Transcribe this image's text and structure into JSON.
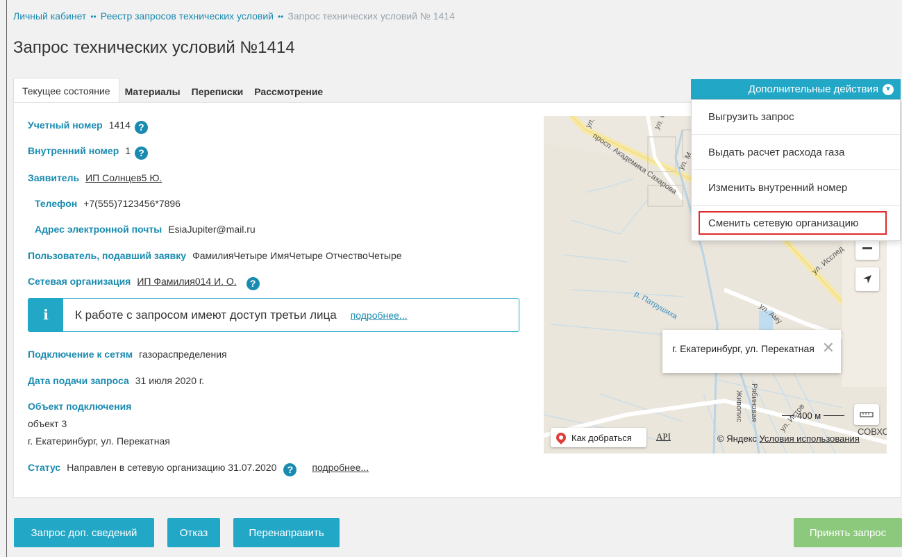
{
  "breadcrumb": {
    "items": [
      "Личный кабинет",
      "Реестр запросов технических условий"
    ],
    "current": "Запрос технических условий № 1414",
    "separator": "••"
  },
  "page_title": "Запрос технических условий №1414",
  "tabs": [
    {
      "label": "Текущее состояние",
      "active": true
    },
    {
      "label": "Материалы",
      "active": false
    },
    {
      "label": "Переписки",
      "active": false
    },
    {
      "label": "Рассмотрение",
      "active": false
    }
  ],
  "fields": {
    "account_number": {
      "label": "Учетный номер",
      "value": "1414"
    },
    "internal_number": {
      "label": "Внутренний номер",
      "value": "1"
    },
    "applicant": {
      "label": "Заявитель",
      "value": "ИП Солнцев5 Ю."
    },
    "phone": {
      "label": "Телефон",
      "value": "+7(555)7123456*7896"
    },
    "email": {
      "label": "Адрес электронной почты",
      "value": "EsiaJupiter@mail.ru"
    },
    "submitter": {
      "label": "Пользователь, подавший заявку",
      "value": "ФамилияЧетыре ИмяЧетыре ОтчествоЧетыре"
    },
    "network_org": {
      "label": "Сетевая организация",
      "value": "ИП Фамилия014 И. О."
    },
    "connection": {
      "label": "Подключение к сетям",
      "value": "газораспределения"
    },
    "date": {
      "label": "Дата подачи запроса",
      "value": "31 июля 2020 г."
    },
    "object": {
      "label": "Объект подключения",
      "name": "объект 3",
      "address": "г. Екатеринбург, ул. Перекатная"
    },
    "status": {
      "label": "Статус",
      "value": "Направлен в сетевую организацию 31.07.2020",
      "link": "подробнее..."
    }
  },
  "notice": {
    "icon": "info-icon",
    "text": "К работе с запросом имеют доступ третьи лица",
    "link": "подробнее..."
  },
  "map": {
    "streets": [
      "ул.",
      "ул. Ч",
      "просп. Академика Сахарова",
      "ул. М",
      "р. Патрушиха",
      "ул. Исслед",
      "ул. Аму",
      "Живопис",
      "Рябиновая",
      "ул. Истов"
    ],
    "balloon": "г. Екатеринбург, ул. Перекатная",
    "route_label": "Как добраться",
    "api_label": "API",
    "copyright": "© Яндекс",
    "terms": "Условия использования",
    "scale": "400 м",
    "corner_text": "СОВХО"
  },
  "actions": {
    "label": "Дополнительные действия",
    "items": [
      "Выгрузить запрос",
      "Выдать расчет расхода газа",
      "Изменить внутренний номер",
      "Сменить сетевую организацию"
    ],
    "highlighted_index": 3,
    "highlight_color": "#e02a2a"
  },
  "buttons": {
    "request_info": "Запрос доп. сведений",
    "reject": "Отказ",
    "redirect": "Перенаправить",
    "accept": "Принять запрос"
  },
  "colors": {
    "accent": "#23a7c7",
    "label": "#1a8bb0",
    "accept": "#8cc97c"
  }
}
